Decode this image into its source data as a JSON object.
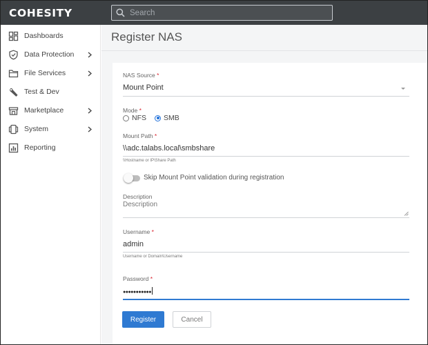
{
  "app": {
    "logo": "COHESITY"
  },
  "search": {
    "placeholder": "Search"
  },
  "sidebar": {
    "items": [
      {
        "label": "Dashboards",
        "icon": "dashboard-grid-icon",
        "has_submenu": false
      },
      {
        "label": "Data Protection",
        "icon": "shield-icon",
        "has_submenu": true
      },
      {
        "label": "File Services",
        "icon": "folder-icon",
        "has_submenu": true
      },
      {
        "label": "Test & Dev",
        "icon": "wrench-icon",
        "has_submenu": false
      },
      {
        "label": "Marketplace",
        "icon": "store-icon",
        "has_submenu": true
      },
      {
        "label": "System",
        "icon": "system-icon",
        "has_submenu": true
      },
      {
        "label": "Reporting",
        "icon": "report-chart-icon",
        "has_submenu": false
      }
    ]
  },
  "page": {
    "title": "Register NAS"
  },
  "form": {
    "nas_source": {
      "label": "NAS Source",
      "required_mark": "*",
      "value": "Mount Point"
    },
    "mode": {
      "label": "Mode",
      "required_mark": "*",
      "options": [
        "NFS",
        "SMB"
      ],
      "selected": "SMB"
    },
    "mount_path": {
      "label": "Mount Path",
      "required_mark": "*",
      "value": "\\\\adc.talabs.local\\smbshare",
      "hint": "\\\\Hostname or IP\\Share Path"
    },
    "skip_validation": {
      "label": "Skip Mount Point validation during registration",
      "enabled": false
    },
    "description": {
      "label": "Description",
      "placeholder": "Description"
    },
    "username": {
      "label": "Username",
      "required_mark": "*",
      "value": "admin",
      "hint": "Username or Domain\\Username"
    },
    "password": {
      "label": "Password",
      "required_mark": "*",
      "value": "●●●●●●●●●●●"
    },
    "register_label": "Register",
    "cancel_label": "Cancel"
  },
  "colors": {
    "topbar": "#3c4043",
    "primary": "#2f7ad2",
    "required": "#d9232e",
    "radio_selected": "#1e6fd9"
  }
}
